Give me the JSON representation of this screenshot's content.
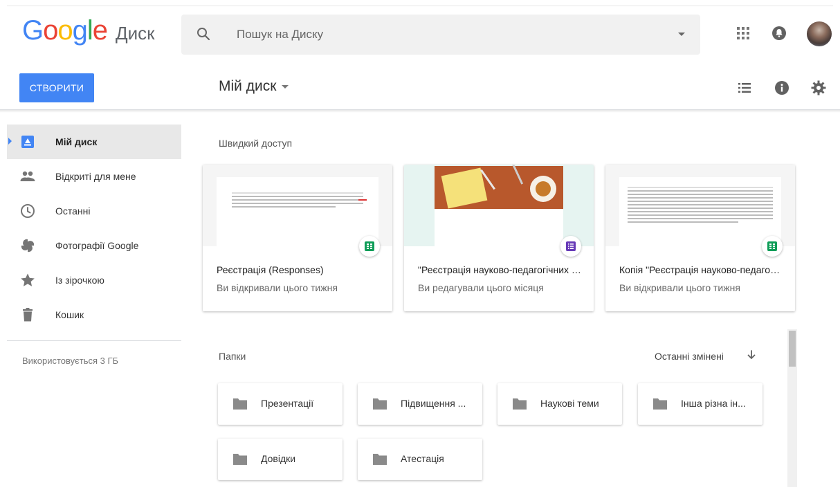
{
  "header": {
    "logo_text": "Google",
    "product_name": "Диск",
    "search": {
      "placeholder": "Пошук на Диску"
    }
  },
  "toolbar": {
    "create_label": "СТВОРИТИ",
    "title": "Мій диск"
  },
  "sidebar": {
    "items": [
      {
        "label": "Мій диск",
        "icon": "my-drive-icon",
        "active": true
      },
      {
        "label": "Відкриті для мене",
        "icon": "shared-icon"
      },
      {
        "label": "Останні",
        "icon": "clock-icon"
      },
      {
        "label": "Фотографії Google",
        "icon": "photos-icon"
      },
      {
        "label": "Із зірочкою",
        "icon": "star-icon"
      },
      {
        "label": "Кошик",
        "icon": "trash-icon"
      }
    ],
    "storage": "Використовується 3 ГБ"
  },
  "quick_access": {
    "label": "Швидкий доступ",
    "cards": [
      {
        "title": "Реєстрація (Responses)",
        "subtitle": "Ви відкривали цього тижня",
        "type": "sheets"
      },
      {
        "title": "\"Реєстрація науково-педагогічних працівників для підвищення кваліфікації\"",
        "subtitle": "Ви редагували цього місяця",
        "type": "forms"
      },
      {
        "title": "Копія \"Реєстрація науково-педагогічних працівників\"",
        "subtitle": "Ви відкривали цього тижня",
        "type": "sheets"
      }
    ]
  },
  "folders": {
    "label": "Папки",
    "sort_label": "Останні змінені",
    "items": [
      {
        "name": "Презентації"
      },
      {
        "name": "Підвищення ..."
      },
      {
        "name": "Наукові теми"
      },
      {
        "name": "Інша різна ін..."
      },
      {
        "name": "Довідки"
      },
      {
        "name": "Атестація"
      }
    ]
  },
  "colors": {
    "accent": "#4285f4",
    "sheets": "#0f9d58",
    "forms": "#673ab7",
    "active_bg": "#e8e8e8"
  }
}
